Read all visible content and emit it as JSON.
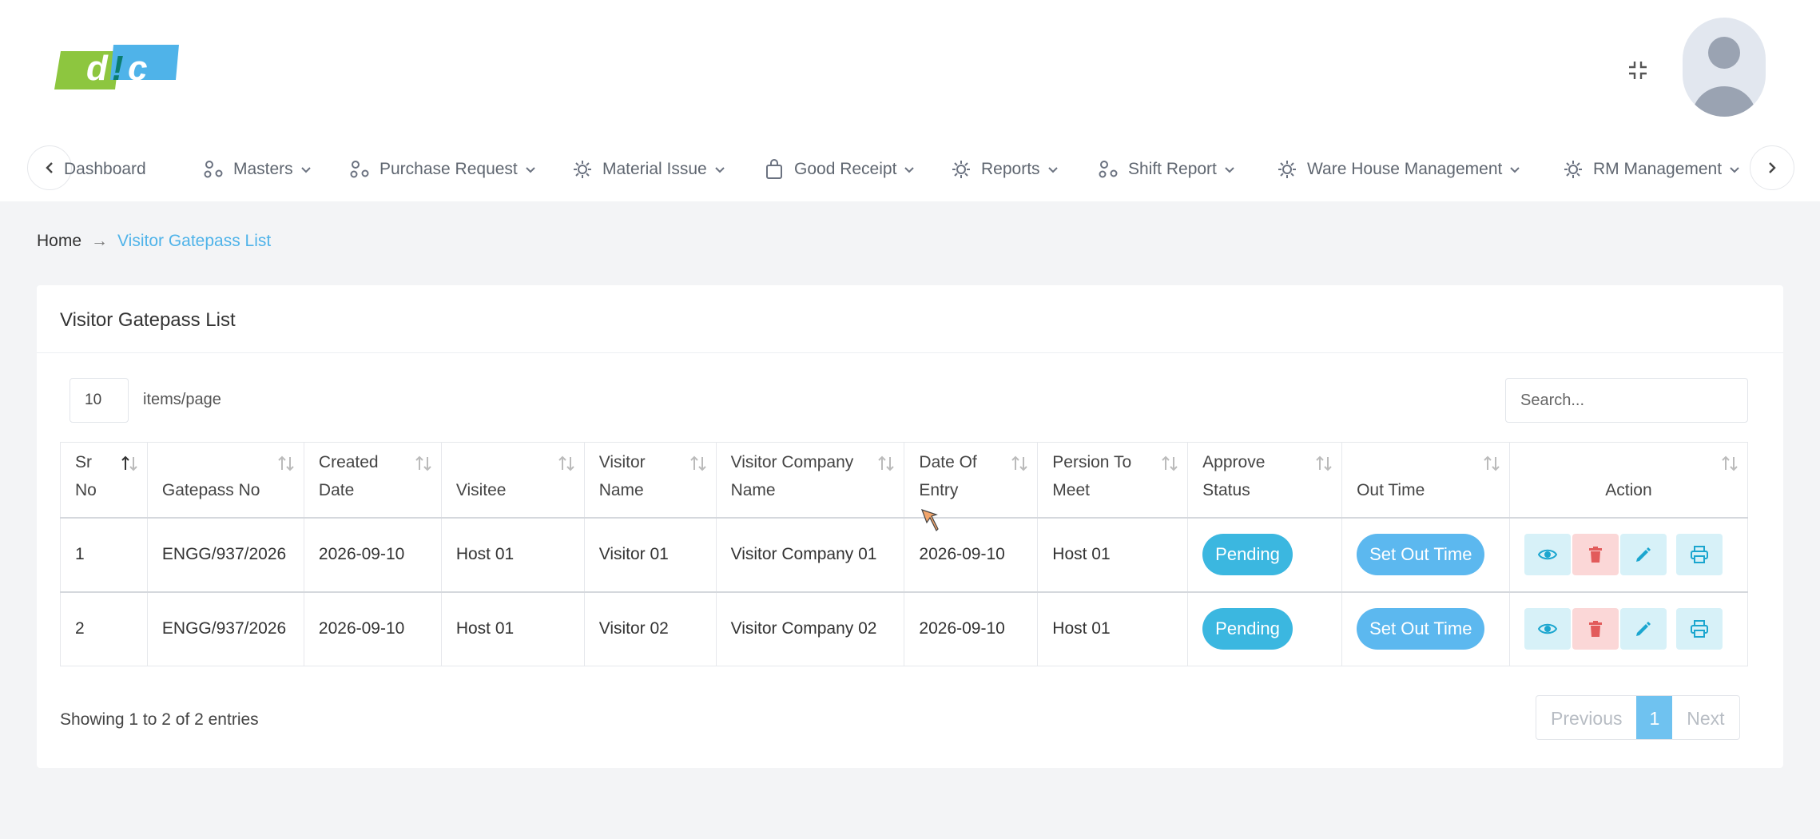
{
  "header": {
    "logo_text": "dic",
    "colors": {
      "brand_green": "#8dc63f",
      "brand_blue": "#4fb3e9",
      "dark": "#0b7d6e"
    }
  },
  "nav": {
    "items": [
      {
        "label": "Dashboard",
        "icon": "dashboard-icon"
      },
      {
        "label": "Masters",
        "icon": "nodes-icon"
      },
      {
        "label": "Purchase Request",
        "icon": "nodes-icon"
      },
      {
        "label": "Material Issue",
        "icon": "gear-icon"
      },
      {
        "label": "Good Receipt",
        "icon": "bag-icon"
      },
      {
        "label": "Reports",
        "icon": "gear-icon"
      },
      {
        "label": "Shift Report",
        "icon": "nodes-icon"
      },
      {
        "label": "Ware House Management",
        "icon": "gear-icon"
      },
      {
        "label": "RM Management",
        "icon": "gear-icon"
      }
    ]
  },
  "breadcrumb": {
    "home": "Home",
    "separator": "→",
    "current": "Visitor Gatepass List"
  },
  "card": {
    "title": "Visitor Gatepass List"
  },
  "controls": {
    "per_page": "10",
    "per_page_label": "items/page",
    "search_placeholder": "Search..."
  },
  "table": {
    "headers": [
      [
        "Sr",
        "No"
      ],
      [
        "",
        "Gatepass No"
      ],
      [
        "Created",
        "Date"
      ],
      [
        "",
        "Visitee"
      ],
      [
        "Visitor",
        "Name"
      ],
      [
        "Visitor Company",
        "Name"
      ],
      [
        "Date Of",
        "Entry"
      ],
      [
        "Persion To",
        "Meet"
      ],
      [
        "Approve",
        "Status"
      ],
      [
        "",
        "Out Time"
      ],
      [
        "",
        "Action"
      ]
    ],
    "rows": [
      {
        "sr": "1",
        "gatepass": "ENGG/937/2026",
        "created": "2026-09-10",
        "visitee": "Host 01",
        "visitor": "Visitor 01",
        "company": "Visitor Company 01",
        "entry": "2026-09-10",
        "meet": "Host 01",
        "status": "Pending",
        "out": "Set Out Time"
      },
      {
        "sr": "2",
        "gatepass": "ENGG/937/2026",
        "created": "2026-09-10",
        "visitee": "Host 01",
        "visitor": "Visitor 02",
        "company": "Visitor Company 02",
        "entry": "2026-09-10",
        "meet": "Host 01",
        "status": "Pending",
        "out": "Set Out Time"
      }
    ]
  },
  "footer": {
    "showing": "Showing 1 to 2 of 2 entries",
    "previous": "Previous",
    "page": "1",
    "next": "Next"
  }
}
